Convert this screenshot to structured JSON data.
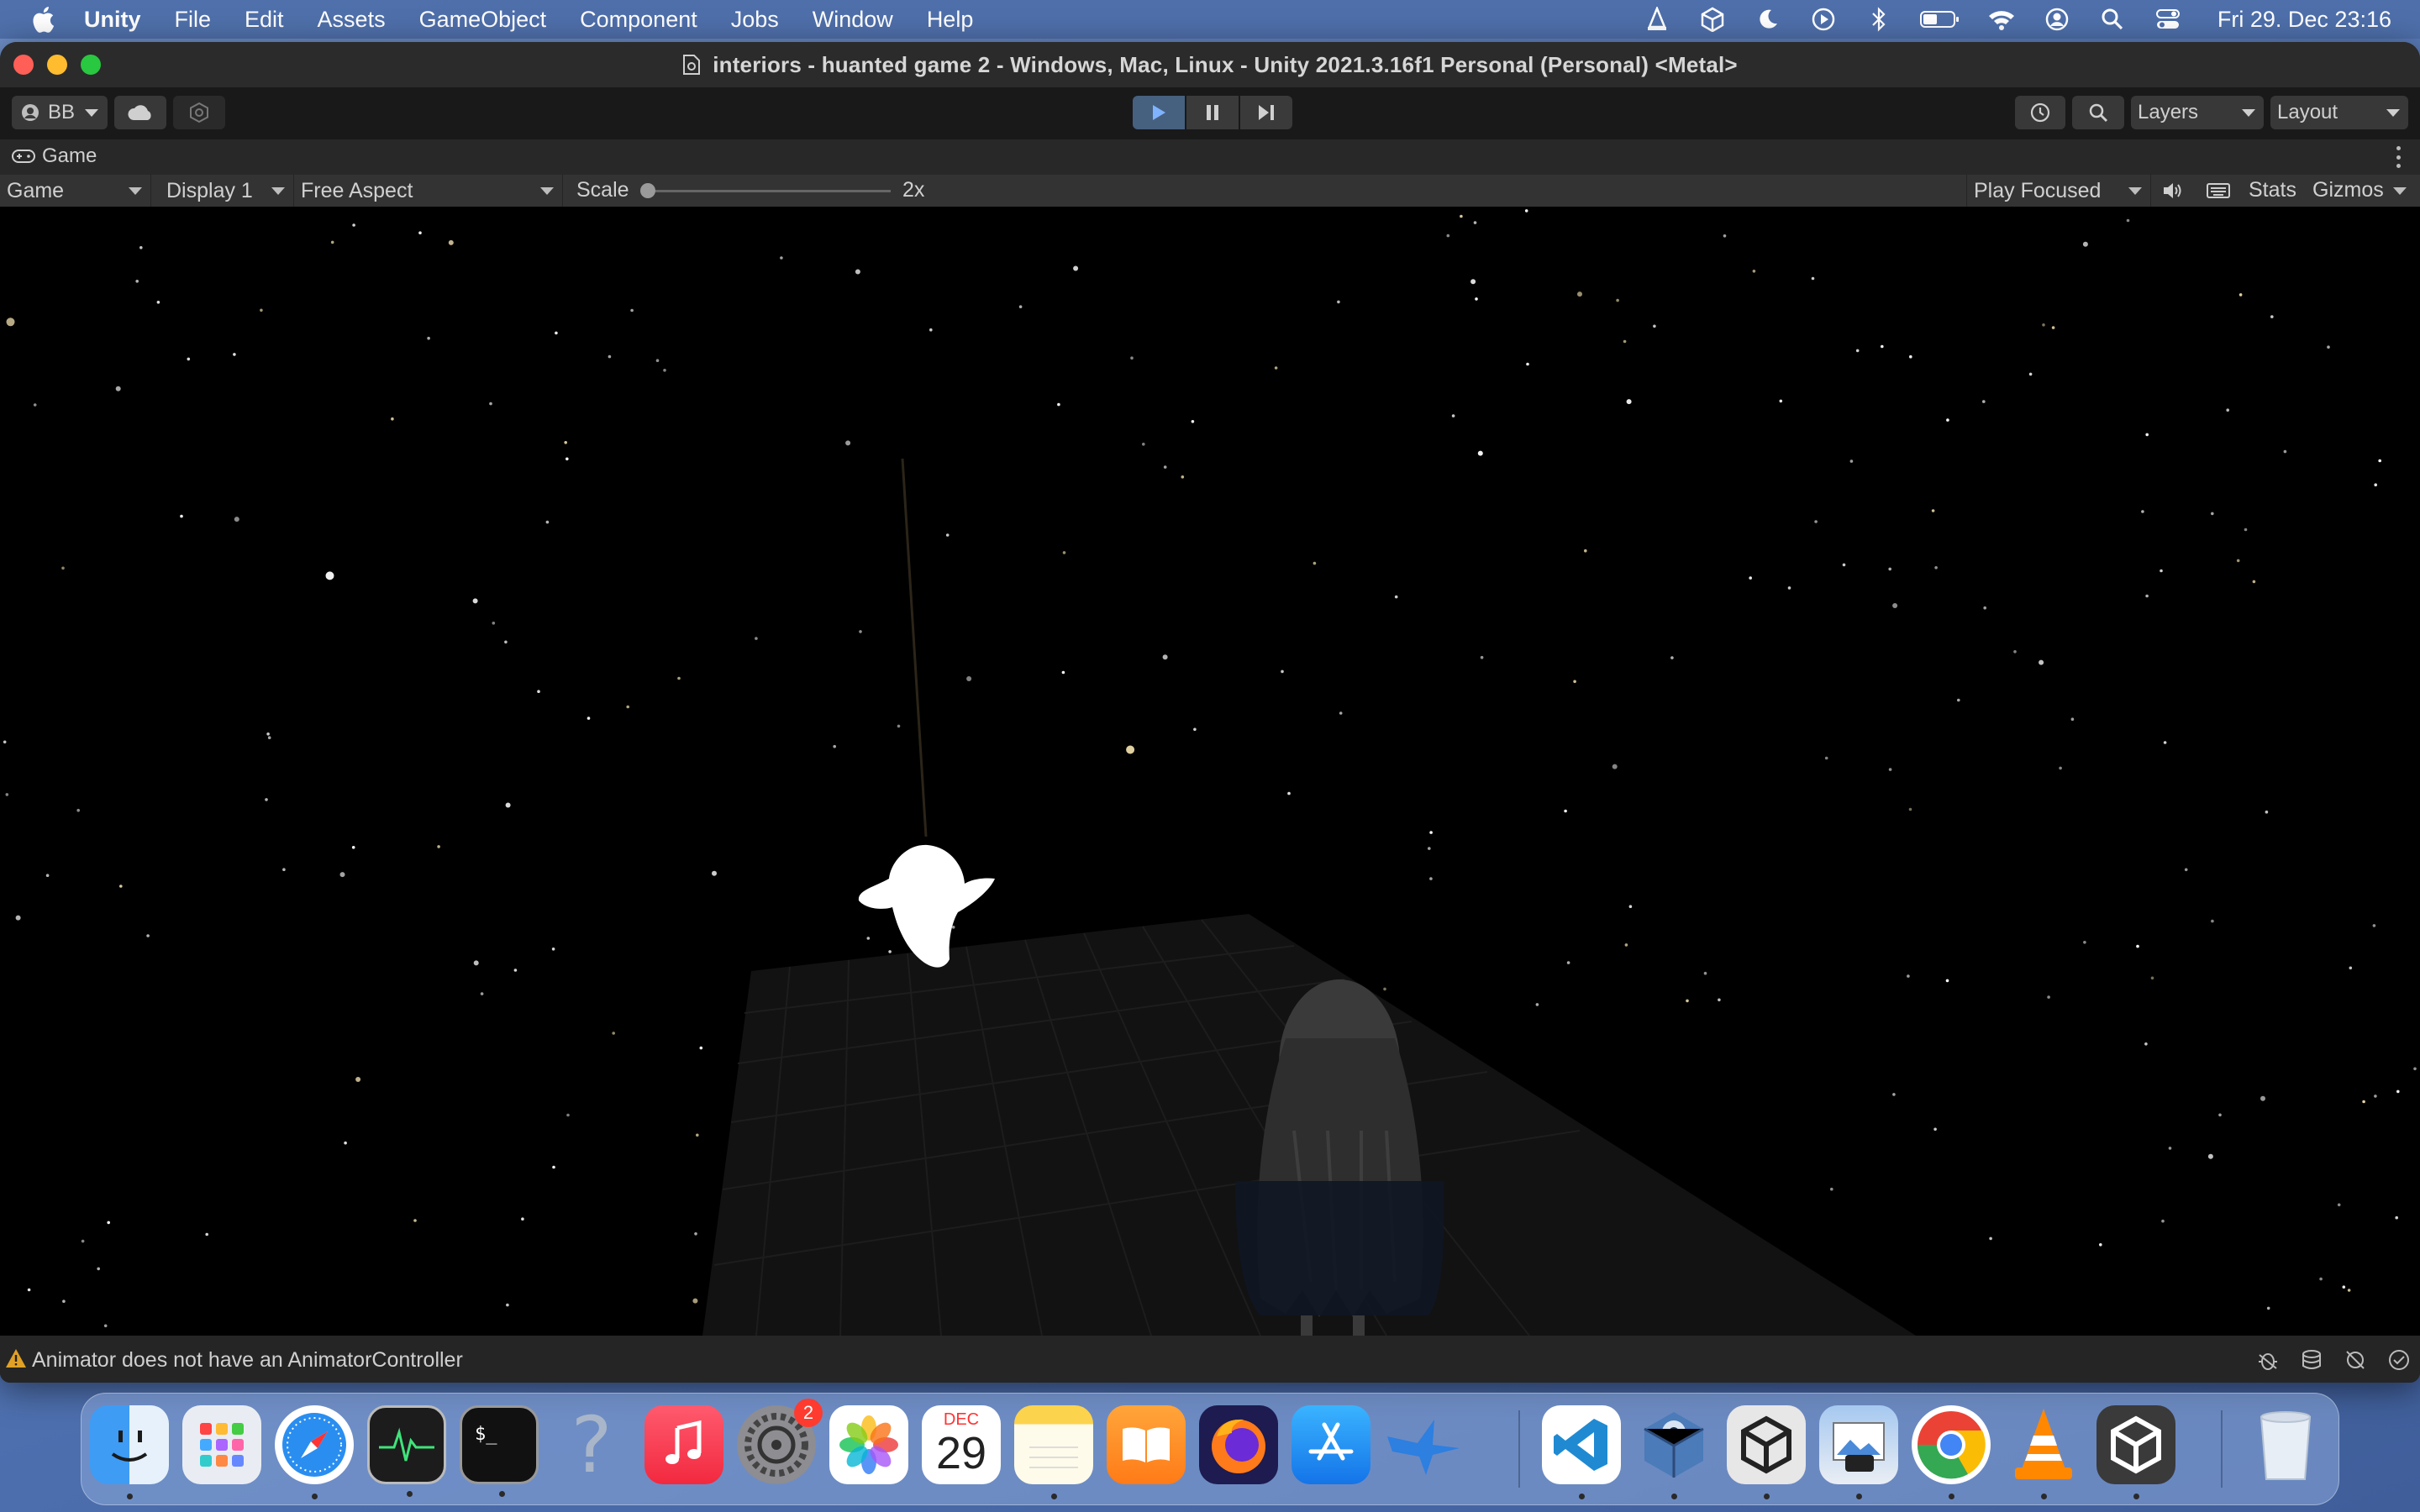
{
  "menubar": {
    "app_name": "Unity",
    "menus": [
      "File",
      "Edit",
      "Assets",
      "GameObject",
      "Component",
      "Jobs",
      "Window",
      "Help"
    ],
    "clock": "Fri 29. Dec  23:16"
  },
  "window": {
    "title": "interiors - huanted game 2 - Windows, Mac, Linux - Unity 2021.3.16f1 Personal (Personal) <Metal>"
  },
  "toolbar": {
    "account_label": "BB",
    "layers_label": "Layers",
    "layout_label": "Layout"
  },
  "game_tab": {
    "label": "Game"
  },
  "game_bar": {
    "view_select": "Game",
    "display_select": "Display 1",
    "aspect_select": "Free Aspect",
    "scale_label": "Scale",
    "scale_value": "2x",
    "play_mode_select": "Play Focused",
    "stats_label": "Stats",
    "gizmos_label": "Gizmos"
  },
  "status": {
    "message": "Animator does not have an AnimatorController"
  },
  "dock": {
    "calendar_month": "DEC",
    "calendar_day": "29",
    "settings_badge": "2",
    "help_glyph": "?"
  },
  "colors": {
    "play_active": "#46607f",
    "warning": "#e0a126",
    "menubar": "#4e6eaa"
  }
}
